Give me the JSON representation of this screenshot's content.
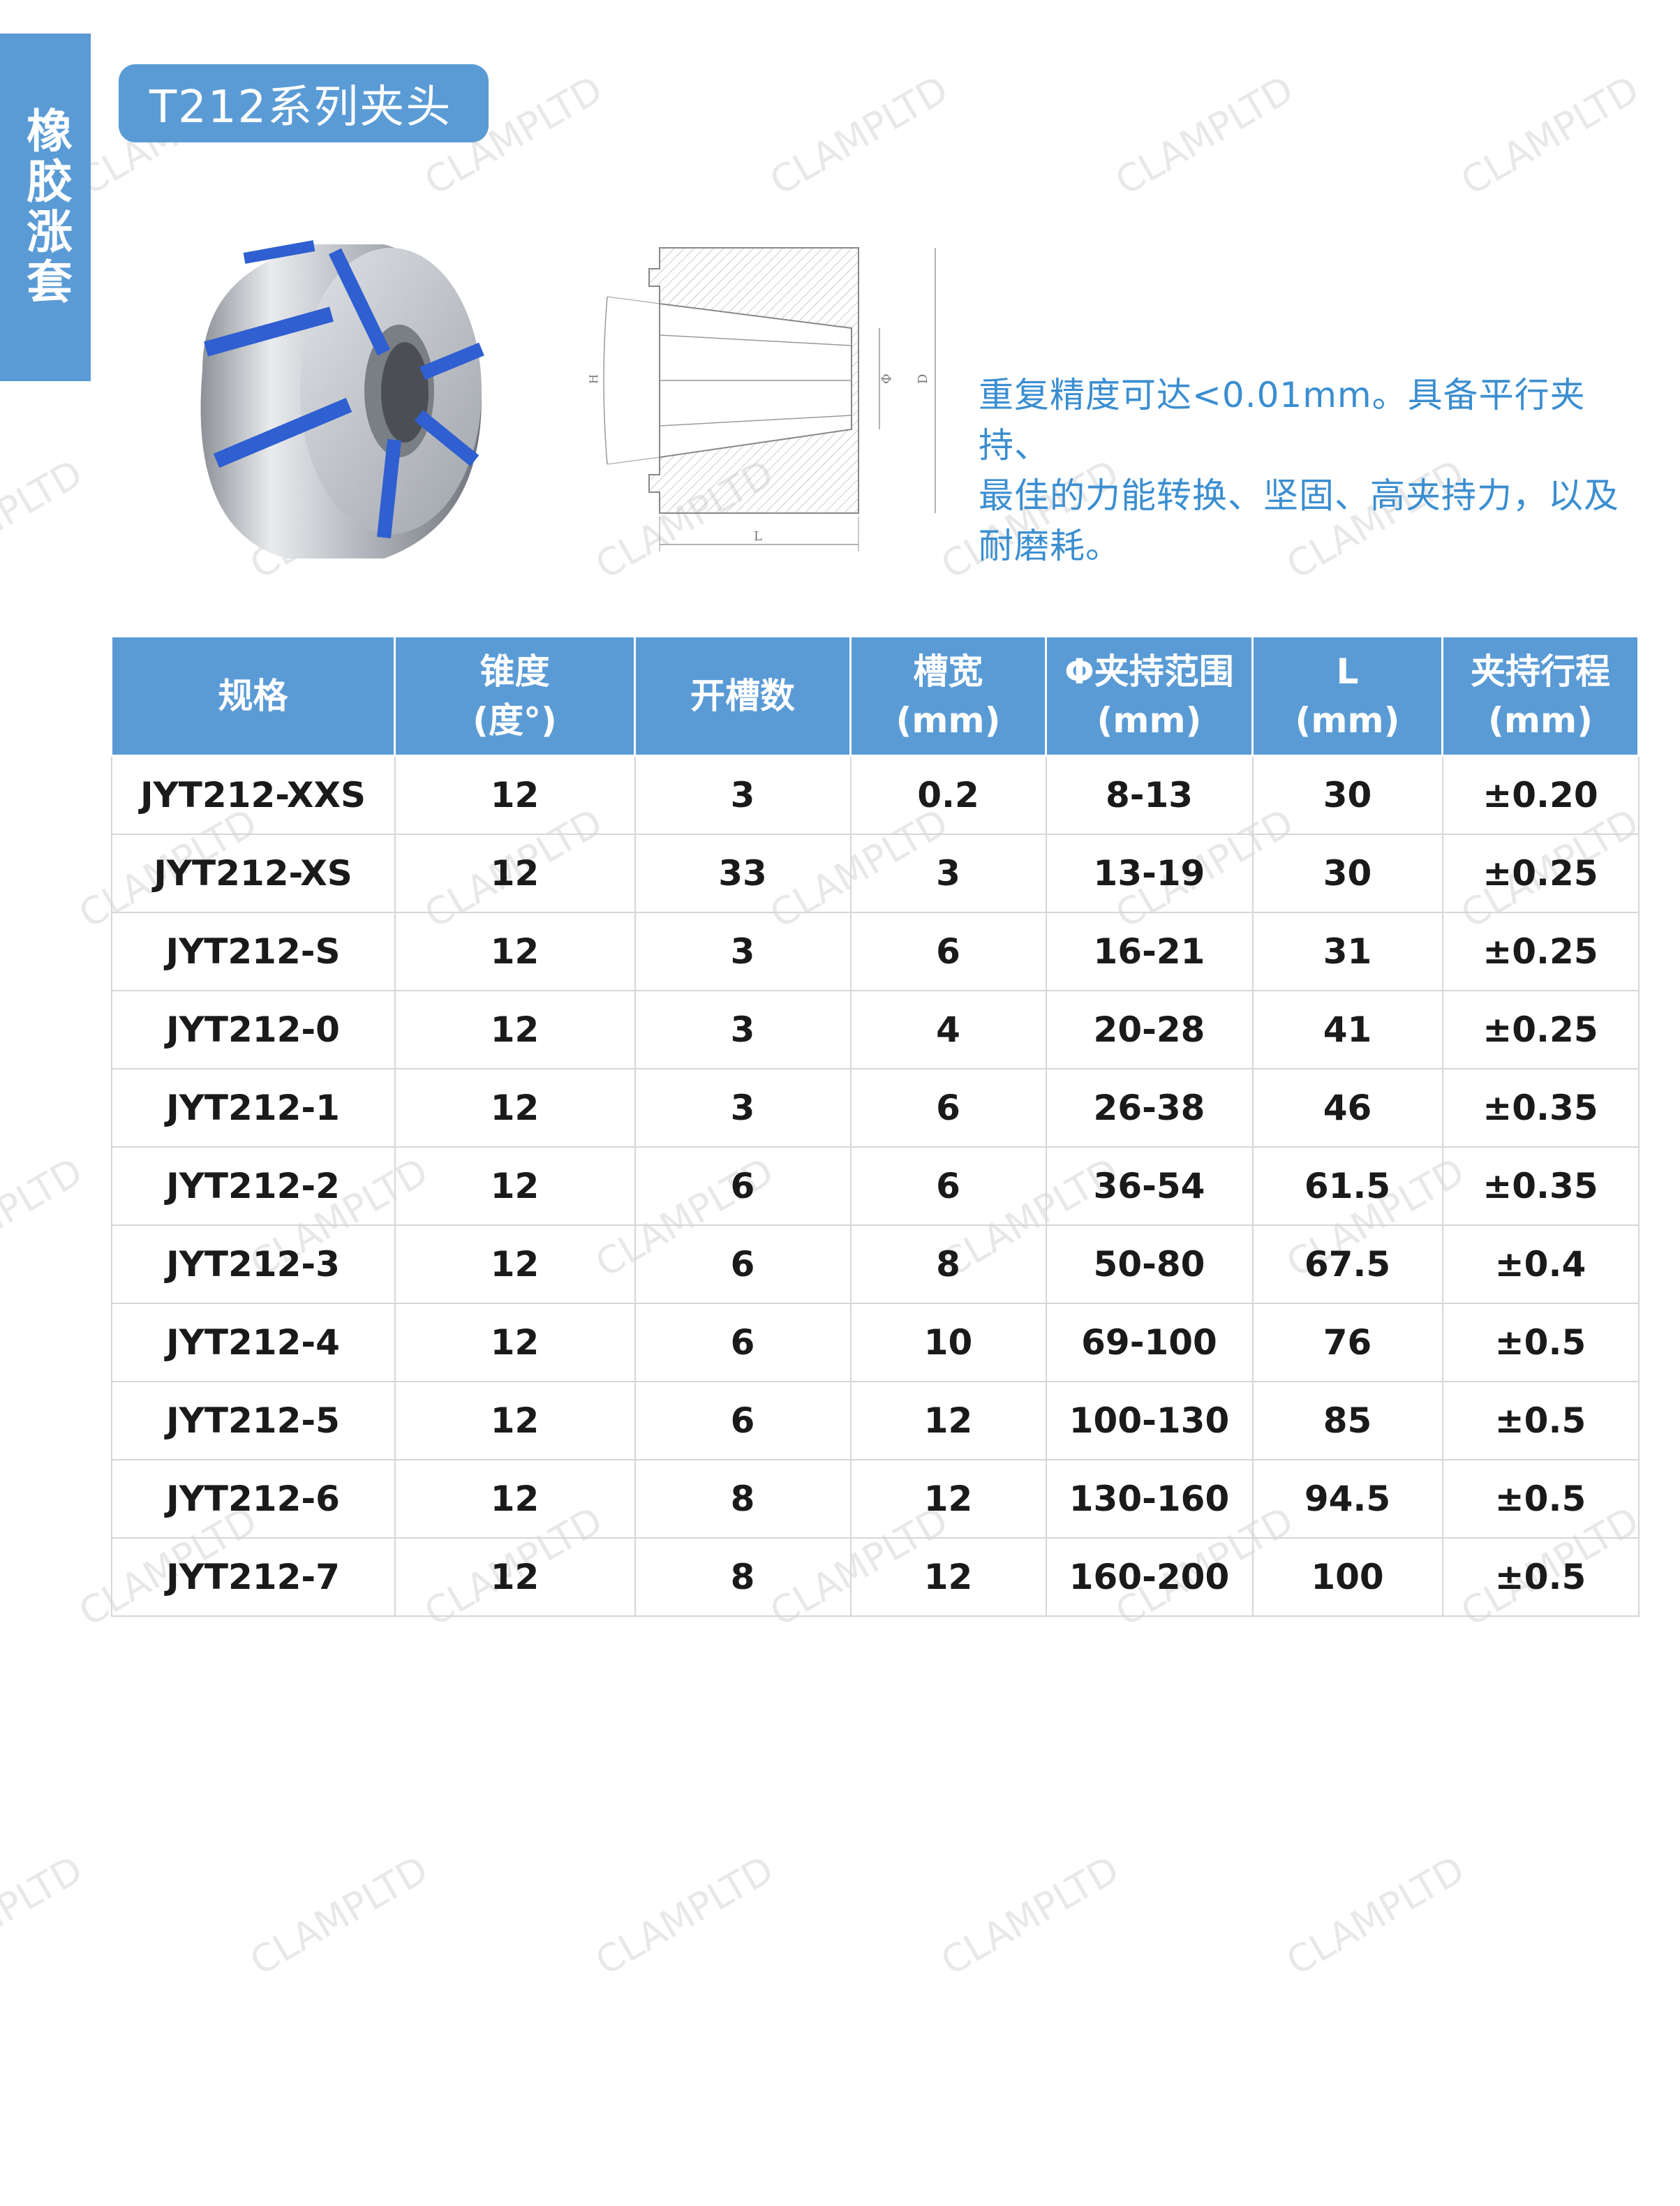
{
  "side_tab": {
    "label": "橡胶涨套"
  },
  "series": {
    "title": "T212系列夹头"
  },
  "description": {
    "lines": [
      "重复精度可达<0.01mm。具备平行夹持、",
      "最佳的力能转换、坚固、高夹持力，以及",
      "耐磨耗。"
    ]
  },
  "drawing": {
    "label_l": "L",
    "label_d": "D",
    "label_phi": "Φ",
    "label_h": "H"
  },
  "watermark": {
    "text": "CLAMPLTD"
  },
  "table": {
    "headers": [
      [
        "规格"
      ],
      [
        "锥度",
        "(度°)"
      ],
      [
        "开槽数"
      ],
      [
        "槽宽",
        "(mm)"
      ],
      [
        "Φ夹持范围",
        "(mm)"
      ],
      [
        "L",
        "(mm)"
      ],
      [
        "夹持行程",
        "(mm)"
      ]
    ],
    "rows": [
      [
        "JYT212-XXS",
        "12",
        "3",
        "0.2",
        "8-13",
        "30",
        "±0.20"
      ],
      [
        "JYT212-XS",
        "12",
        "33",
        "3",
        "13-19",
        "30",
        "±0.25"
      ],
      [
        "JYT212-S",
        "12",
        "3",
        "6",
        "16-21",
        "31",
        "±0.25"
      ],
      [
        "JYT212-0",
        "12",
        "3",
        "4",
        "20-28",
        "41",
        "±0.25"
      ],
      [
        "JYT212-1",
        "12",
        "3",
        "6",
        "26-38",
        "46",
        "±0.35"
      ],
      [
        "JYT212-2",
        "12",
        "6",
        "6",
        "36-54",
        "61.5",
        "±0.35"
      ],
      [
        "JYT212-3",
        "12",
        "6",
        "8",
        "50-80",
        "67.5",
        "±0.4"
      ],
      [
        "JYT212-4",
        "12",
        "6",
        "10",
        "69-100",
        "76",
        "±0.5"
      ],
      [
        "JYT212-5",
        "12",
        "6",
        "12",
        "100-130",
        "85",
        "±0.5"
      ],
      [
        "JYT212-6",
        "12",
        "8",
        "12",
        "130-160",
        "94.5",
        "±0.5"
      ],
      [
        "JYT212-7",
        "12",
        "8",
        "12",
        "160-200",
        "100",
        "±0.5"
      ]
    ]
  },
  "colors": {
    "accent": "#5a9bd5",
    "text_blue": "#3b8ed0",
    "rubber_blue": "#2f5fd0"
  }
}
